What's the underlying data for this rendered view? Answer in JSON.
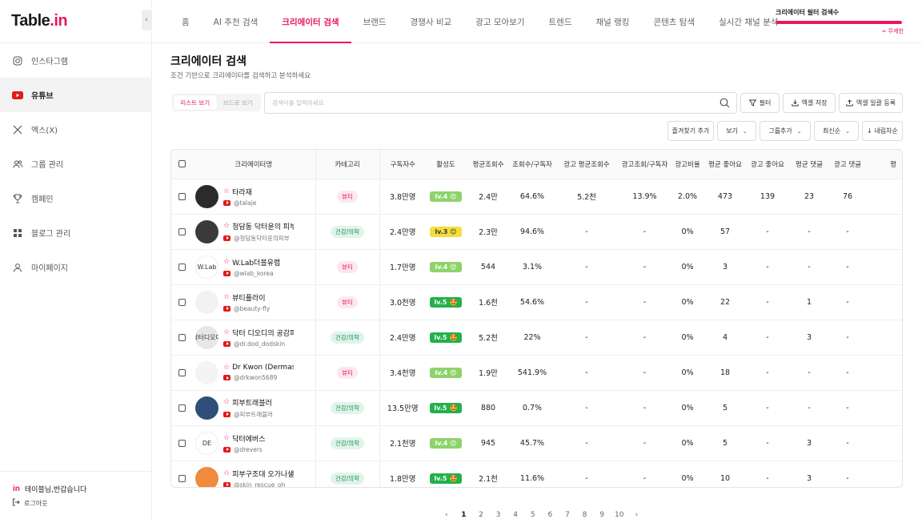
{
  "brand": {
    "logo_main": "Table",
    "logo_dot": ".",
    "logo_in": "in",
    "accent": "#e8175d"
  },
  "sidebar": {
    "items": [
      {
        "label": "인스타그램",
        "icon": "instagram-icon"
      },
      {
        "label": "유튜브",
        "icon": "youtube-icon"
      },
      {
        "label": "엑스(X)",
        "icon": "x-icon"
      },
      {
        "label": "그룹 관리",
        "icon": "group-icon"
      },
      {
        "label": "캠페인",
        "icon": "trophy-icon"
      },
      {
        "label": "블로그 관리",
        "icon": "grid-icon"
      },
      {
        "label": "마이페이지",
        "icon": "user-icon"
      }
    ],
    "greeting_logo": "in",
    "greeting": "테이블님,반갑습니다",
    "logout": "로그아웃"
  },
  "tabs": [
    "홈",
    "AI 추천 검색",
    "크리에이터 검색",
    "브랜드",
    "경쟁사 비교",
    "광고 모아보기",
    "트렌드",
    "채널 랭킹",
    "콘텐츠 탐색",
    "실시간 채널 분석"
  ],
  "quota": {
    "label": "크리에이터 필터 검색수",
    "value_label": "∞ 무제한",
    "fill_fraction": 1.0
  },
  "page": {
    "title": "크리에이터 검색",
    "subtitle": "조건 기반으로 크리에이터를 검색하고 분석하세요"
  },
  "view_toggle": {
    "list": "리스트 보기",
    "board": "보드로 보기"
  },
  "search": {
    "placeholder": "검색어를 입력하세요",
    "value": ""
  },
  "toolbar": {
    "filter": "필터",
    "excel_save": "엑셀 저장",
    "excel_bulk": "엑셀 일괄 등록",
    "add_favorite": "즐겨찾기 추가",
    "view": "보기",
    "group_add": "그룹추가",
    "sort_latest": "최신순",
    "sort_desc": "↓ 내림차순"
  },
  "table": {
    "headers": [
      "크리에이터명",
      "카테고리",
      "구독자수",
      "활성도",
      "평균조회수",
      "조회수/구독자",
      "광고 평균조회수",
      "광고조회/구독자",
      "광고비율",
      "평균 좋아요",
      "광고 좋아요",
      "평균 댓글",
      "광고 댓글",
      "평"
    ],
    "rows": [
      {
        "name": "타라재",
        "handle": "@talaje",
        "category": "뷰티",
        "cat_type": "beauty",
        "subs": "3.8만명",
        "level": "lv.4",
        "level_class": "lv4",
        "face": "😍",
        "avg_views": "2.4만",
        "views_per_sub": "64.6%",
        "ad_avg_views": "5.2천",
        "ad_views_per_sub": "13.9%",
        "ad_ratio": "2.0%",
        "avg_likes": "473",
        "ad_likes": "139",
        "avg_comments": "23",
        "ad_comments": "76",
        "avatar_bg": "#2b2b2b",
        "avatar_text": ""
      },
      {
        "name": "청담동 닥터윤의 피부",
        "handle": "@청담동닥터윤의피부",
        "category": "건강/의학",
        "cat_type": "health",
        "subs": "2.4만명",
        "level": "lv.3",
        "level_class": "lv3",
        "face": "😊",
        "avg_views": "2.3만",
        "views_per_sub": "94.6%",
        "ad_avg_views": "-",
        "ad_views_per_sub": "-",
        "ad_ratio": "0%",
        "avg_likes": "57",
        "ad_likes": "-",
        "avg_comments": "-",
        "ad_comments": "-",
        "avatar_bg": "#3a3a3a",
        "avatar_text": ""
      },
      {
        "name": "W.Lab더블유랩",
        "handle": "@wlab_korea",
        "category": "뷰티",
        "cat_type": "beauty",
        "subs": "1.7만명",
        "level": "lv.4",
        "level_class": "lv4",
        "face": "😍",
        "avg_views": "544",
        "views_per_sub": "3.1%",
        "ad_avg_views": "-",
        "ad_views_per_sub": "-",
        "ad_ratio": "0%",
        "avg_likes": "3",
        "ad_likes": "-",
        "avg_comments": "-",
        "ad_comments": "-",
        "avatar_bg": "#ffffff",
        "avatar_text": "W.Lab"
      },
      {
        "name": "뷰티플라이",
        "handle": "@beauty-fly",
        "category": "뷰티",
        "cat_type": "beauty",
        "subs": "3.0천명",
        "level": "lv.5",
        "level_class": "lv5",
        "face": "🤩",
        "avg_views": "1.6천",
        "views_per_sub": "54.6%",
        "ad_avg_views": "-",
        "ad_views_per_sub": "-",
        "ad_ratio": "0%",
        "avg_likes": "22",
        "ad_likes": "-",
        "avg_comments": "1",
        "ad_comments": "-",
        "avatar_bg": "#f2f2f2",
        "avatar_text": ""
      },
      {
        "name": "닥터 디오디의 공감피부",
        "handle": "@dr.dod_dodskin",
        "category": "건강/의학",
        "cat_type": "health",
        "subs": "2.4만명",
        "level": "lv.5",
        "level_class": "lv5",
        "face": "🤩",
        "avg_views": "5.2천",
        "views_per_sub": "22%",
        "ad_avg_views": "-",
        "ad_views_per_sub": "-",
        "ad_ratio": "0%",
        "avg_likes": "4",
        "ad_likes": "-",
        "avg_comments": "3",
        "ad_comments": "-",
        "avatar_bg": "#e7e7e7",
        "avatar_text": "닥터디오디"
      },
      {
        "name": "Dr Kwon (Dermas",
        "handle": "@drkwon5689",
        "category": "뷰티",
        "cat_type": "beauty",
        "subs": "3.4천명",
        "level": "lv.4",
        "level_class": "lv4",
        "face": "😍",
        "avg_views": "1.9만",
        "views_per_sub": "541.9%",
        "ad_avg_views": "-",
        "ad_views_per_sub": "-",
        "ad_ratio": "0%",
        "avg_likes": "18",
        "ad_likes": "-",
        "avg_comments": "-",
        "ad_comments": "-",
        "avatar_bg": "#f4f4f4",
        "avatar_text": ""
      },
      {
        "name": "피부트래블러",
        "handle": "@피부트래블러",
        "category": "건강/의학",
        "cat_type": "health",
        "subs": "13.5만명",
        "level": "lv.5",
        "level_class": "lv5",
        "face": "🤩",
        "avg_views": "880",
        "views_per_sub": "0.7%",
        "ad_avg_views": "-",
        "ad_views_per_sub": "-",
        "ad_ratio": "0%",
        "avg_likes": "5",
        "ad_likes": "-",
        "avg_comments": "-",
        "ad_comments": "-",
        "avatar_bg": "#2d4f7a",
        "avatar_text": ""
      },
      {
        "name": "닥터에버스",
        "handle": "@drevers",
        "category": "건강/의학",
        "cat_type": "health",
        "subs": "2.1천명",
        "level": "lv.4",
        "level_class": "lv4",
        "face": "😍",
        "avg_views": "945",
        "views_per_sub": "45.7%",
        "ad_avg_views": "-",
        "ad_views_per_sub": "-",
        "ad_ratio": "0%",
        "avg_likes": "5",
        "ad_likes": "-",
        "avg_comments": "3",
        "ad_comments": "-",
        "avatar_bg": "#ffffff",
        "avatar_text": "DE"
      },
      {
        "name": "피부구조대 오가나샐",
        "handle": "@skin_rescue_oh",
        "category": "건강/의학",
        "cat_type": "health",
        "subs": "1.8만명",
        "level": "lv.5",
        "level_class": "lv5",
        "face": "🤩",
        "avg_views": "2.1천",
        "views_per_sub": "11.6%",
        "ad_avg_views": "-",
        "ad_views_per_sub": "-",
        "ad_ratio": "0%",
        "avg_likes": "10",
        "ad_likes": "-",
        "avg_comments": "3",
        "ad_comments": "-",
        "avatar_bg": "#f08a3c",
        "avatar_text": ""
      }
    ]
  },
  "pagination": {
    "prev": "‹",
    "next": "›",
    "pages": [
      "1",
      "2",
      "3",
      "4",
      "5",
      "6",
      "7",
      "8",
      "9",
      "10"
    ],
    "active": "1"
  }
}
